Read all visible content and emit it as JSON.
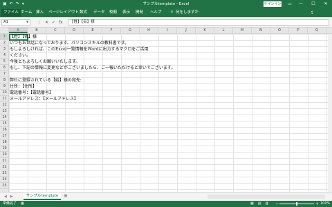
{
  "window": {
    "title": "サンプルtemplate - Excel",
    "signin_label": "サインイン",
    "qat_icons": [
      "save-icon",
      "undo-icon",
      "redo-icon",
      "customize-icon"
    ],
    "qat_glyphs": [
      "▣",
      "↶",
      "↷",
      "▾"
    ],
    "controls": {
      "ribbon": "▭",
      "minimize": "—",
      "maximize": "☐",
      "close": "✕"
    }
  },
  "ribbon": {
    "tabs": [
      "ファイル",
      "ホーム",
      "挿入",
      "ページレイアウト",
      "数式",
      "データ",
      "校閲",
      "表示",
      "開発",
      "ヘルプ"
    ],
    "tell_me_icon": "☼",
    "tell_me": "何をしますか",
    "share_icon": "⇪"
  },
  "formula_bar": {
    "name_box": "A1",
    "icons": [
      "⋮",
      "✕",
      "✓",
      "fx"
    ],
    "content": "【姓】【名】様"
  },
  "grid": {
    "columns": [
      "A",
      "B",
      "C",
      "D",
      "E",
      "F",
      "G",
      "H",
      "I",
      "J",
      "K",
      "L",
      "M",
      "N",
      "O",
      "P",
      "Q"
    ],
    "rows": [
      "1",
      "2",
      "3",
      "4",
      "5",
      "6",
      "7",
      "8",
      "9",
      "10",
      "11",
      "12",
      "13",
      "14",
      "15",
      "16",
      "17",
      "18",
      "19",
      "20",
      "21",
      "22",
      "23",
      "24",
      "25"
    ],
    "cells": [
      "【姓】【名】様",
      "いつもお世話になっております。パソコンスキルの教科書です。",
      "もしよろしければ、このExcel一覧情報をWordに出力するマクロをご活用",
      "ください。",
      "今後ともよろしくお願いいたします。",
      "もし、下記の情報に変更などがございましたら、ご一報いただけると幸いでございます。",
      "",
      "弊社に登録されている【姓】様の宛先:",
      "住所：【住所】",
      "電話番号：【電話番号】",
      "メールアドレス：【メールアドレス】"
    ]
  },
  "sheets": {
    "nav": [
      "◀",
      "▶"
    ],
    "active": "サンプルtemplate",
    "add": "⊕"
  },
  "status": {
    "mode": "準備完了",
    "mode_icon": "▦",
    "views": [
      "▦",
      "▤",
      "▥"
    ],
    "zoom_minus": "−",
    "zoom_plus": "+",
    "zoom": "100%"
  }
}
